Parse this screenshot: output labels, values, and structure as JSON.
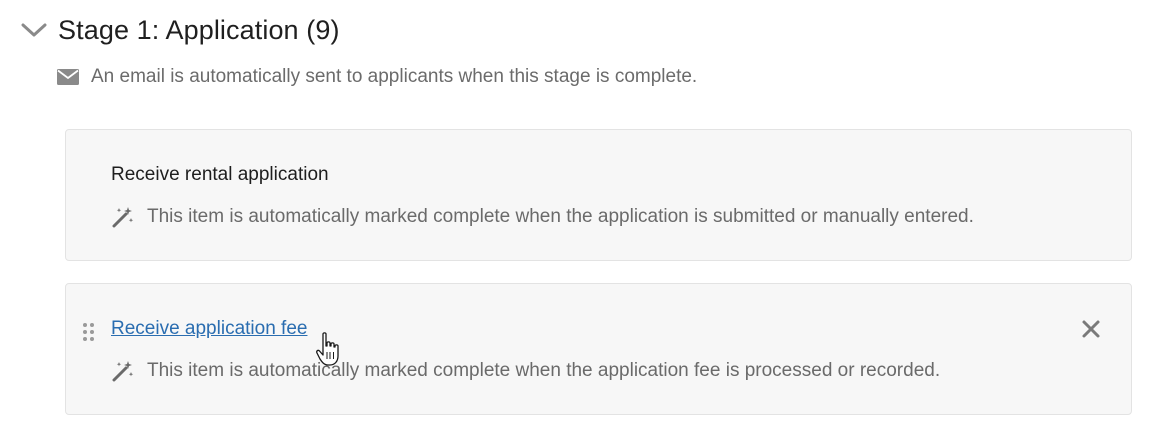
{
  "stage": {
    "title": "Stage 1: Application (9)",
    "collapse_icon": "chevron-down-icon",
    "email_icon": "envelope-icon",
    "email_note": "An email is automatically sent to applicants when this stage is complete."
  },
  "items": [
    {
      "title": "Receive rental application",
      "auto_icon": "magic-wand-icon",
      "description": "This item is automatically marked complete when the application is submitted or manually entered."
    },
    {
      "title": "Receive application fee",
      "auto_icon": "magic-wand-icon",
      "drag_icon": "drag-handle-icon",
      "remove_icon": "close-icon",
      "description": "This item is automatically marked complete when the application fee is processed or recorded."
    }
  ],
  "colors": {
    "link": "#2a6db0",
    "card_bg": "#f7f7f7",
    "muted_text": "#6a6a6a"
  }
}
